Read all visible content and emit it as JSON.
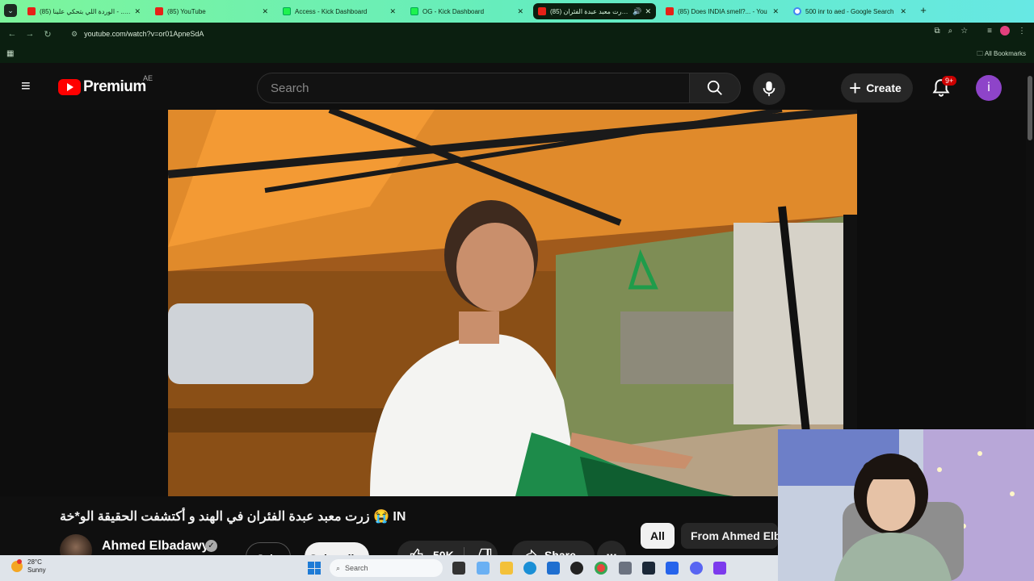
{
  "browser": {
    "tabs": [
      {
        "title": "(85) الوردة اللي بتحكي علينا - ...be",
        "favicon": "youtube-icon",
        "active": false
      },
      {
        "title": "(85) YouTube",
        "favicon": "youtube-icon",
        "active": false
      },
      {
        "title": "Access - Kick Dashboard",
        "favicon": "kick-icon",
        "active": false
      },
      {
        "title": "OG - Kick Dashboard",
        "favicon": "kick-icon",
        "active": false
      },
      {
        "title": "(85) زرت معبد عبدة الفئران ...",
        "favicon": "youtube-icon",
        "active": true
      },
      {
        "title": "(85) Does INDIA smell?... - You",
        "favicon": "youtube-icon",
        "active": false
      },
      {
        "title": "500 inr to aed - Google Search",
        "favicon": "google-icon",
        "active": false
      }
    ],
    "url": "youtube.com/watch?v=or01ApneSdA",
    "bookmarks_label": "All Bookmarks"
  },
  "youtube": {
    "logo_text": "Premium",
    "country_code": "AE",
    "search_placeholder": "Search",
    "create_label": "Create",
    "notification_badge": "9+",
    "avatar_letter": "i"
  },
  "video": {
    "title": "زرت معبد عبدة الفئران في الهند و أكتشفت الحقيقة الو*خة 😭 IN",
    "channel_name": "Ahmed Elbadawy",
    "join_label": "Join",
    "subscribe_label": "Subscribe",
    "like_count": "50K",
    "share_label": "Share",
    "more_label": "..."
  },
  "chips": {
    "all": "All",
    "from": "From Ahmed Elbadawy"
  },
  "taskbar": {
    "temperature": "28°C",
    "condition": "Sunny",
    "search_label": "Search"
  },
  "colors": {
    "accent_red": "#ff0000",
    "tabstrip_green": "#7df59b",
    "page_bg": "#0f0f0f"
  }
}
